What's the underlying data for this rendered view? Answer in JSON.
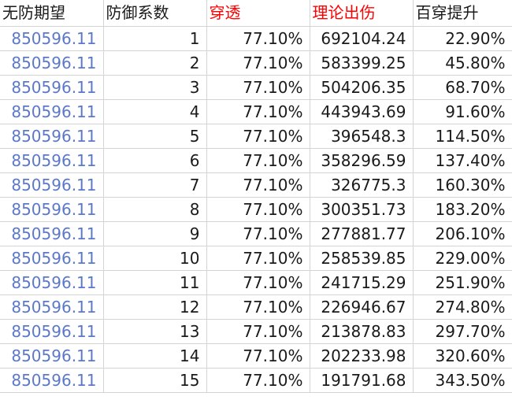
{
  "headers": [
    "无防期望",
    "防御系数",
    "穿透",
    "理论出伤",
    "百穿提升"
  ],
  "header_colors": [
    "#1a1a1a",
    "#1a1a1a",
    "#ff0000",
    "#ff0000",
    "#1a1a1a"
  ],
  "first_col_color": "#5b78c9",
  "rows": [
    [
      "850596.11",
      "1",
      "77.10%",
      "692104.24",
      "22.90%"
    ],
    [
      "850596.11",
      "2",
      "77.10%",
      "583399.25",
      "45.80%"
    ],
    [
      "850596.11",
      "3",
      "77.10%",
      "504206.35",
      "68.70%"
    ],
    [
      "850596.11",
      "4",
      "77.10%",
      "443943.69",
      "91.60%"
    ],
    [
      "850596.11",
      "5",
      "77.10%",
      "396548.3",
      "114.50%"
    ],
    [
      "850596.11",
      "6",
      "77.10%",
      "358296.59",
      "137.40%"
    ],
    [
      "850596.11",
      "7",
      "77.10%",
      "326775.3",
      "160.30%"
    ],
    [
      "850596.11",
      "8",
      "77.10%",
      "300351.73",
      "183.20%"
    ],
    [
      "850596.11",
      "9",
      "77.10%",
      "277881.77",
      "206.10%"
    ],
    [
      "850596.11",
      "10",
      "77.10%",
      "258539.85",
      "229.00%"
    ],
    [
      "850596.11",
      "11",
      "77.10%",
      "241715.29",
      "251.90%"
    ],
    [
      "850596.11",
      "12",
      "77.10%",
      "226946.67",
      "274.80%"
    ],
    [
      "850596.11",
      "13",
      "77.10%",
      "213878.83",
      "297.70%"
    ],
    [
      "850596.11",
      "14",
      "77.10%",
      "202233.98",
      "320.60%"
    ],
    [
      "850596.11",
      "15",
      "77.10%",
      "191791.68",
      "343.50%"
    ]
  ]
}
